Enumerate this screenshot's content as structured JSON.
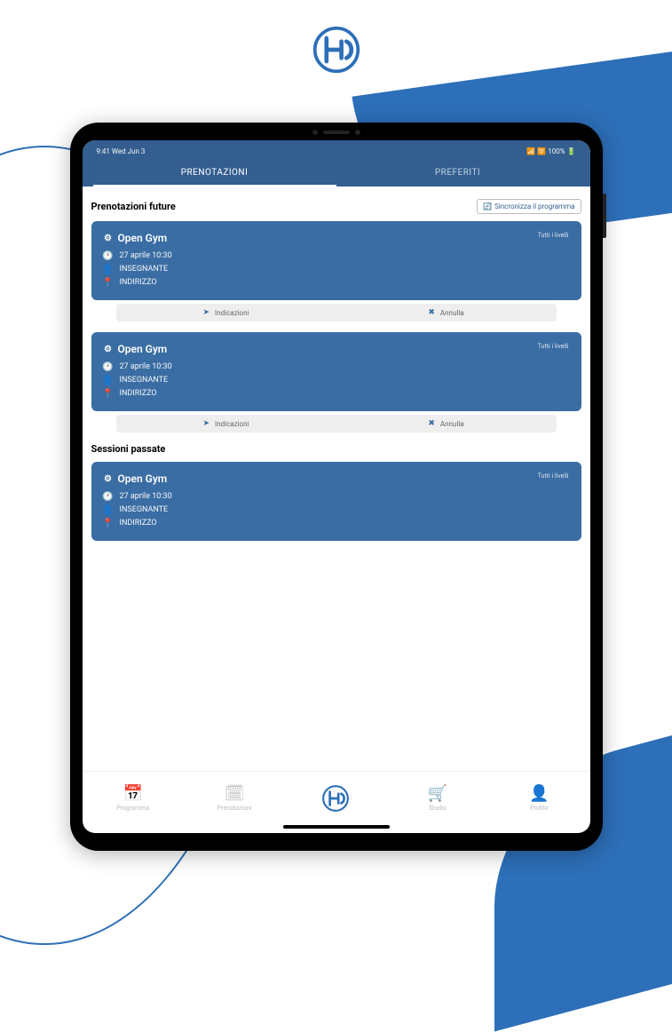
{
  "status": {
    "left": "9:41 Wed Jun 3",
    "right": "📶 🛜 100% 🔋"
  },
  "tabs": {
    "prenotazioni": "PRENOTAZIONI",
    "preferiti": "PREFERITI"
  },
  "sync_button": "Sincronizza il programma",
  "sections": {
    "future": "Prenotazioni future",
    "past": "Sessioni passate"
  },
  "card": {
    "title": "Open Gym",
    "badge": "Tutti i livelli",
    "date": "27 aprile 10:30",
    "teacher": "INSEGNANTE",
    "address": "INDIRIZZO"
  },
  "actions": {
    "directions": "Indicazioni",
    "cancel": "Annulla"
  },
  "nav": {
    "programma": "Programma",
    "prenotazioni": "Prenotazioni",
    "studio": "Studio",
    "profilo": "Profilo"
  }
}
